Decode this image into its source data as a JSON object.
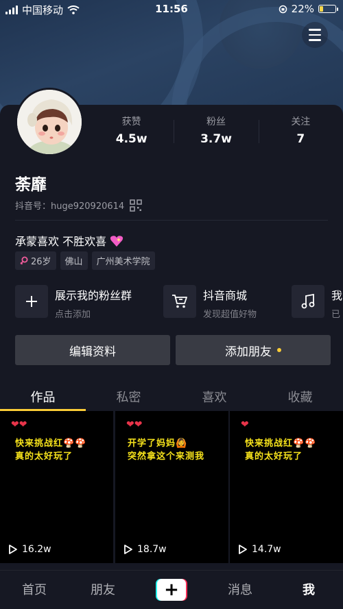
{
  "status_bar": {
    "carrier": "中国移动",
    "time": "11:56",
    "battery": "22%",
    "battery_level": 0.22
  },
  "profile": {
    "nickname": "荼靡",
    "douyin_id": "抖音号：huge920920614",
    "bio": "承蒙喜欢 不胜欢喜",
    "stats": [
      {
        "label": "获赞",
        "value": "4.5w"
      },
      {
        "label": "粉丝",
        "value": "3.7w"
      },
      {
        "label": "关注",
        "value": "7"
      }
    ],
    "tags": {
      "age": "26岁",
      "city": "佛山",
      "school": "广州美术学院"
    }
  },
  "features": [
    {
      "title": "展示我的粉丝群",
      "subtitle": "点击添加",
      "icon": "plus-icon"
    },
    {
      "title": "抖音商城",
      "subtitle": "发现超值好物",
      "icon": "cart-icon"
    },
    {
      "title": "我",
      "subtitle": "已",
      "icon": "music-icon"
    }
  ],
  "actions": {
    "edit_profile": "编辑资料",
    "add_friend": "添加朋友"
  },
  "tabs": [
    "作品",
    "私密",
    "喜欢",
    "收藏"
  ],
  "videos": [
    {
      "line1": "快来挑战红🍄🍄",
      "line2": "真的太好玩了",
      "views": "16.2w"
    },
    {
      "line1": "开学了妈妈🙆",
      "line2": "突然拿这个来测我",
      "views": "18.7w"
    },
    {
      "line1": "快来挑战红🍄🍄",
      "line2": "真的太好玩了",
      "views": "14.7w"
    }
  ],
  "bottom_nav": {
    "home": "首页",
    "friends": "朋友",
    "messages": "消息",
    "me": "我"
  },
  "colors": {
    "background": "#161823",
    "accent": "#facc37",
    "button": "#393b44"
  }
}
